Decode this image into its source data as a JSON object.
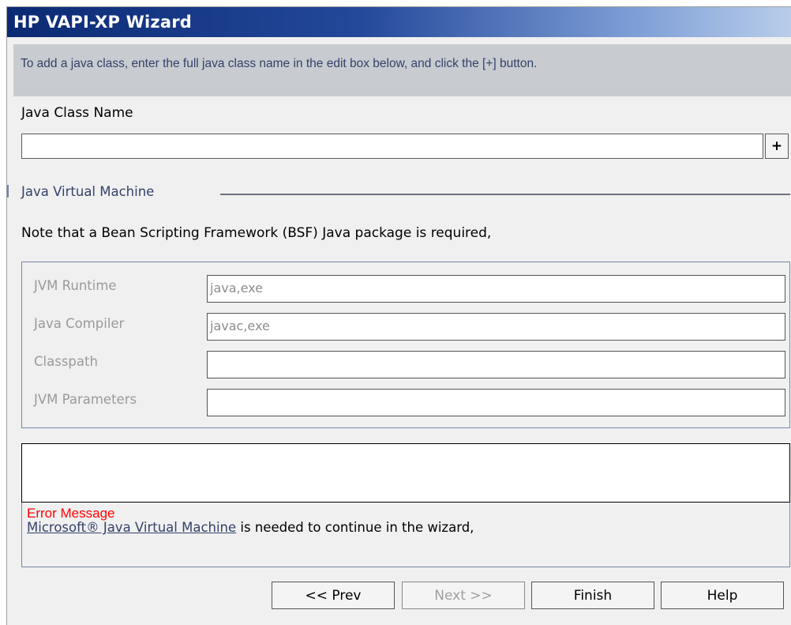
{
  "window": {
    "title": "HP VAPI-XP Wizard"
  },
  "info": {
    "text": "To add a java class, enter the full java class name in the edit box below, and click the [+] button."
  },
  "java_class": {
    "label": "Java Class Name",
    "value": "",
    "add_button": "+"
  },
  "jvm_section": {
    "title": "Java Virtual Machine",
    "note": "Note that a Bean Scripting Framework (BSF) Java package is required,"
  },
  "fields": [
    {
      "label": "JVM Runtime",
      "value": "java,exe"
    },
    {
      "label": "Java Compiler",
      "value": "javac,exe"
    },
    {
      "label": "Classpath",
      "value": ""
    },
    {
      "label": "JVM Parameters",
      "value": ""
    }
  ],
  "error": {
    "title": "Error Message",
    "link_text": "Microsoft® Java Virtual Machine",
    "message": " is needed to continue in the wizard,"
  },
  "buttons": {
    "prev": "<< Prev",
    "next": "Next >>",
    "finish": "Finish",
    "help": "Help"
  },
  "colors": {
    "title_bar_start": "#0b2a73",
    "info_bg": "#c8cbd0",
    "error": "#ff0000",
    "link": "#34416a"
  }
}
